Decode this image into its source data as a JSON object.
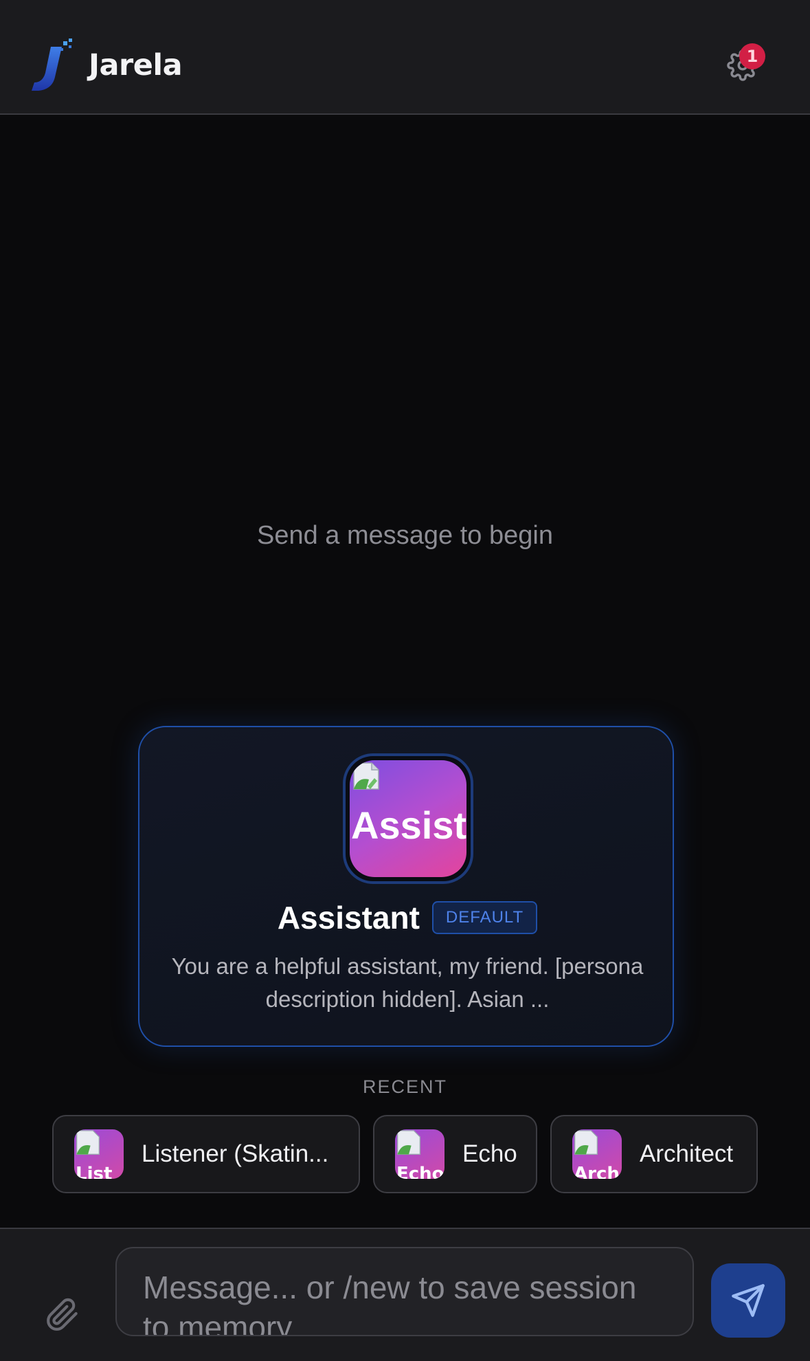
{
  "header": {
    "app_title": "Jarela",
    "notification_count": "1"
  },
  "chat": {
    "empty_hint": "Send a message to begin"
  },
  "persona": {
    "avatar_text": "Assistant",
    "name": "Assistant",
    "badge": "DEFAULT",
    "description": "You are a helpful assistant, my friend. [persona description hidden]. Asian ..."
  },
  "recent": {
    "label": "RECENT",
    "items": [
      {
        "label": "Listener (Skatin...",
        "avatar_text": "List"
      },
      {
        "label": "Echo",
        "avatar_text": "Echo"
      },
      {
        "label": "Architect",
        "avatar_text": "Arch"
      }
    ]
  },
  "composer": {
    "placeholder": "Message... or /new to save session to memory"
  },
  "colors": {
    "accent": "#1f4fa8",
    "badge_red": "#d21f45",
    "avatar_gradient_start": "#7d4ee0",
    "avatar_gradient_end": "#e4449c"
  },
  "icons": [
    "logo-icon",
    "gear-icon",
    "paperclip-icon",
    "send-icon",
    "broken-image-icon"
  ]
}
